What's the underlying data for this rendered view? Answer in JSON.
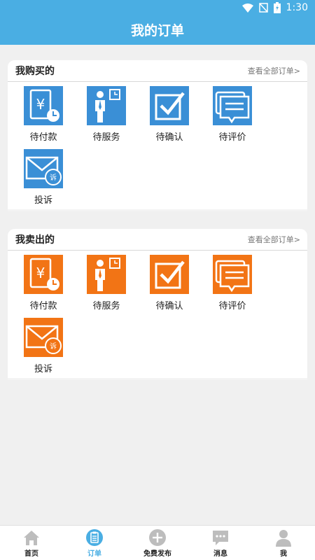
{
  "status_bar": {
    "time": "1:30"
  },
  "header": {
    "title": "我的订单"
  },
  "colors": {
    "primary": "#4aaee3",
    "buy_tile": "#3a8fd6",
    "sell_tile": "#f27415"
  },
  "buy_section": {
    "title": "我购买的",
    "view_all": "查看全部订单>",
    "items": [
      {
        "label": "待付款",
        "icon": "payment-pending-icon"
      },
      {
        "label": "待服务",
        "icon": "service-pending-icon"
      },
      {
        "label": "待确认",
        "icon": "confirm-pending-icon"
      },
      {
        "label": "待评价",
        "icon": "review-pending-icon"
      },
      {
        "label": "投诉",
        "icon": "complaint-icon"
      }
    ]
  },
  "sell_section": {
    "title": "我卖出的",
    "view_all": "查看全部订单>",
    "items": [
      {
        "label": "待付款",
        "icon": "payment-pending-icon"
      },
      {
        "label": "待服务",
        "icon": "service-pending-icon"
      },
      {
        "label": "待确认",
        "icon": "confirm-pending-icon"
      },
      {
        "label": "待评价",
        "icon": "review-pending-icon"
      },
      {
        "label": "投诉",
        "icon": "complaint-icon"
      }
    ]
  },
  "tabbar": {
    "items": [
      {
        "label": "首页",
        "icon": "home-icon"
      },
      {
        "label": "订单",
        "icon": "order-icon",
        "active": true
      },
      {
        "label": "免费发布",
        "icon": "plus-circle-icon"
      },
      {
        "label": "消息",
        "icon": "message-icon"
      },
      {
        "label": "我",
        "icon": "user-icon"
      }
    ]
  }
}
